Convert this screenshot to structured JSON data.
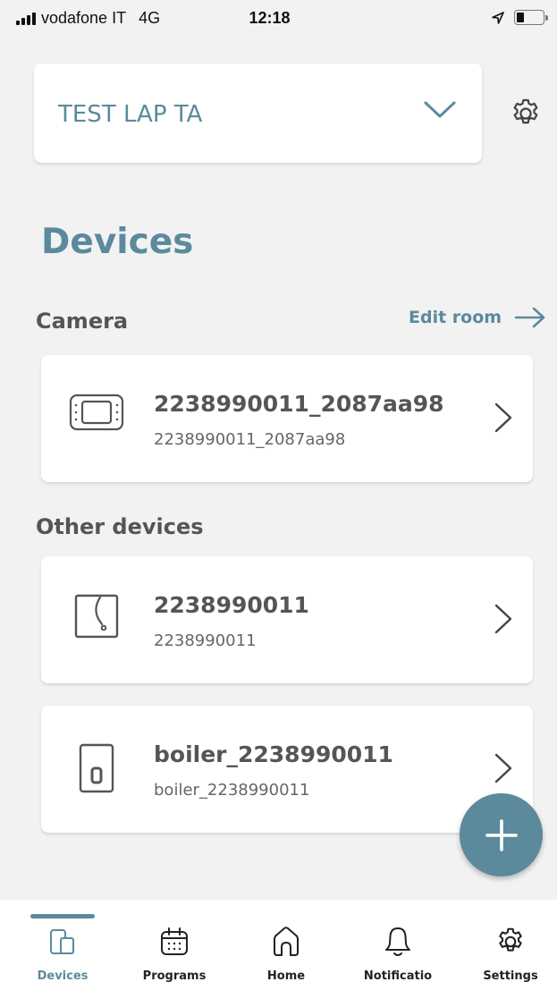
{
  "status_bar": {
    "carrier": "vodafone IT",
    "network": "4G",
    "time": "12:18",
    "icons": [
      "signal-icon",
      "location-arrow-icon",
      "battery-icon"
    ]
  },
  "home_selector": {
    "name": "TEST LAP TA",
    "icon": "chevron-down-icon"
  },
  "page_title": "Devices",
  "sections": [
    {
      "title": "Camera",
      "action_label": "Edit room",
      "devices": [
        {
          "name": "2238990011_2087aa98",
          "id": "2238990011_2087aa98",
          "icon": "thermostat-icon"
        }
      ]
    },
    {
      "title": "Other devices",
      "devices": [
        {
          "name": "2238990011",
          "id": "2238990011",
          "icon": "wall-switch-icon"
        },
        {
          "name": "boiler_2238990011",
          "id": "boiler_2238990011",
          "icon": "boiler-icon"
        }
      ]
    }
  ],
  "fab": {
    "icon": "plus-icon"
  },
  "bottom_nav": {
    "items": [
      {
        "label": "Devices",
        "icon": "devices-icon",
        "active": true
      },
      {
        "label": "Programs",
        "icon": "calendar-icon",
        "active": false
      },
      {
        "label": "Home",
        "icon": "home-icon",
        "active": false
      },
      {
        "label": "Notificatio",
        "icon": "bell-icon",
        "active": false
      },
      {
        "label": "Settings",
        "icon": "gear-icon",
        "active": false
      }
    ]
  },
  "colors": {
    "accent": "#5b8a9c",
    "background": "#f2f2f2",
    "card": "#ffffff",
    "text_dark": "#555555"
  }
}
